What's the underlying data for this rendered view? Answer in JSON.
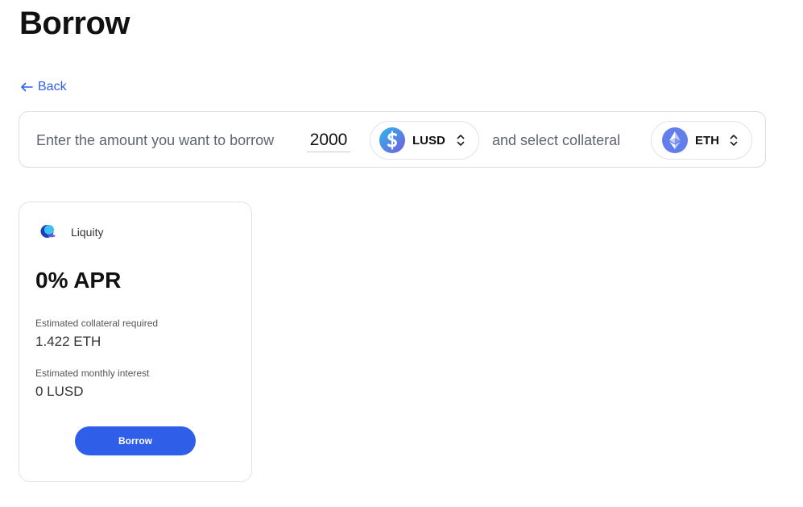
{
  "page": {
    "title": "Borrow"
  },
  "nav": {
    "back_label": "Back"
  },
  "search": {
    "prompt": "Enter the amount you want to borrow",
    "amount": "2000",
    "borrow_token": {
      "label": "LUSD",
      "icon": "lusd-token-icon"
    },
    "collateral_prompt": "and select collateral",
    "collateral_token": {
      "label": "ETH",
      "icon": "eth-token-icon"
    }
  },
  "offers": [
    {
      "provider": "Liquity",
      "provider_icon": "liquity-logo-icon",
      "apr": "0% APR",
      "collateral_label": "Estimated collateral required",
      "collateral_value": "1.422 ETH",
      "interest_label": "Estimated monthly interest",
      "interest_value": "0 LUSD",
      "action_label": "Borrow"
    }
  ],
  "colors": {
    "accent": "#2f5fe8",
    "border": "#dfe2e8",
    "muted_text": "#5f6470",
    "lusd_blue": "#2eb6ea",
    "lusd_purple": "#745ddf",
    "eth_purple": "#627eea"
  }
}
